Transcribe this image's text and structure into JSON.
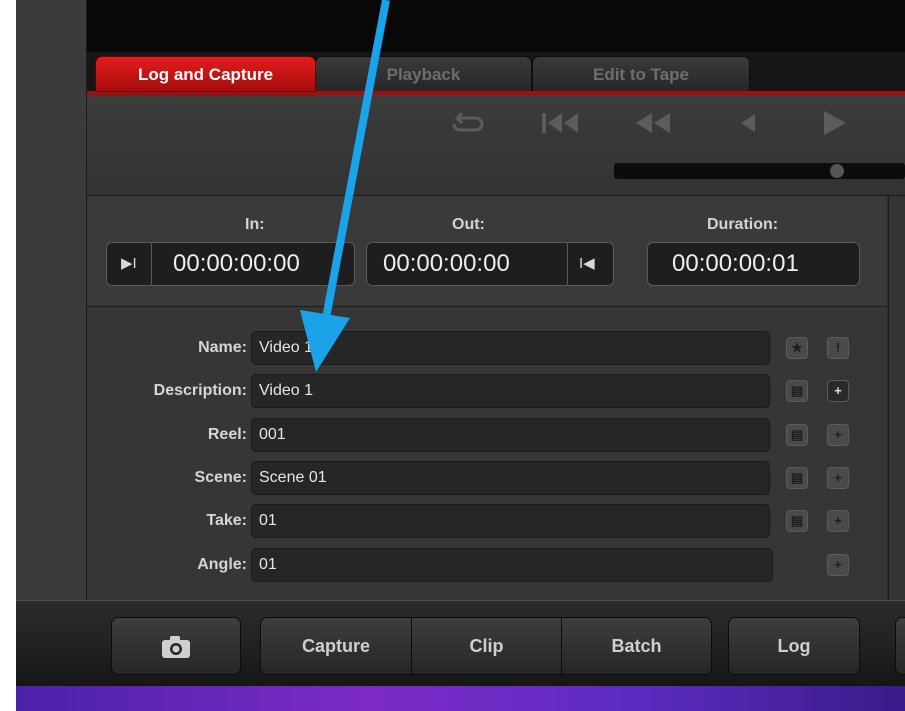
{
  "tabs": [
    {
      "label": "Log and Capture",
      "active": true
    },
    {
      "label": "Playback",
      "active": false
    },
    {
      "label": "Edit to Tape",
      "active": false
    }
  ],
  "transport": {
    "icons": [
      "loop-icon",
      "jump-to-start-icon",
      "rewind-icon",
      "play-reverse-icon",
      "play-icon"
    ]
  },
  "timecode": {
    "in_label": "In:",
    "in_value": "00:00:00:00",
    "out_label": "Out:",
    "out_value": "00:00:00:00",
    "duration_label": "Duration:",
    "duration_value": "00:00:00:01"
  },
  "fields": [
    {
      "label": "Name:",
      "value": "Video 1"
    },
    {
      "label": "Description:",
      "value": "Video 1"
    },
    {
      "label": "Reel:",
      "value": "001"
    },
    {
      "label": "Scene:",
      "value": "Scene 01"
    },
    {
      "label": "Take:",
      "value": "01"
    },
    {
      "label": "Angle:",
      "value": "01"
    }
  ],
  "buttons": {
    "camera": "camera-icon",
    "capture": "Capture",
    "clip": "Clip",
    "batch": "Batch",
    "log": "Log"
  },
  "colors": {
    "active_tab": "#c81414",
    "annotation_arrow": "#1aa3e8"
  }
}
